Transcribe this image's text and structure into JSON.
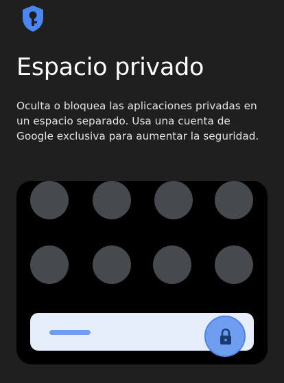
{
  "header": {
    "icon": "shield-key-icon",
    "title": "Espacio privado",
    "description": "Oculta o bloquea las aplicaciones privadas en un espacio separado. Usa una cuenta de Google exclusiva para aumentar la seguridad."
  },
  "illustration": {
    "app_placeholders": 8,
    "unlock_icon": "lock-icon"
  },
  "colors": {
    "background": "#1f1f1f",
    "accent": "#4a86f4",
    "placeholder": "#46494d",
    "panel": "#000000"
  }
}
